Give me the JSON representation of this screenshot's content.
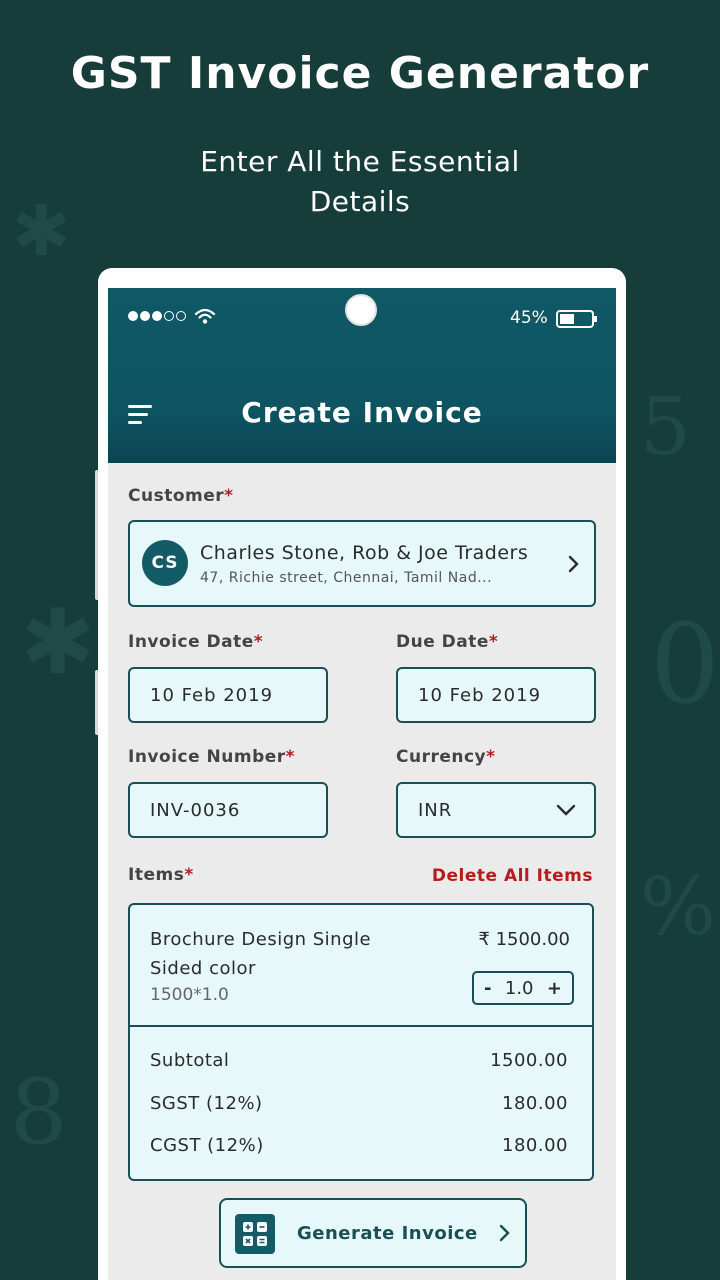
{
  "promo": {
    "title": "GST Invoice Generator",
    "subtitle": "Enter All the Essential Details"
  },
  "status_bar": {
    "battery_percent": "45%",
    "signal_bars_filled": 3,
    "signal_bars_total": 5
  },
  "app_bar": {
    "title": "Create Invoice",
    "menu_icon": "menu-icon"
  },
  "customer": {
    "label": "Customer",
    "required_mark": "*",
    "initials": "CS",
    "name": "Charles Stone, Rob & Joe Traders",
    "address": "47, Richie street, Chennai, Tamil Nad..."
  },
  "invoice_date": {
    "label": "Invoice Date",
    "required_mark": "*",
    "value": "10 Feb 2019"
  },
  "due_date": {
    "label": "Due Date",
    "required_mark": "*",
    "value": "10 Feb 2019"
  },
  "invoice_number": {
    "label": "Invoice Number",
    "required_mark": "*",
    "value": "INV-0036"
  },
  "currency": {
    "label": "Currency",
    "required_mark": "*",
    "value": "INR"
  },
  "items": {
    "label": "Items",
    "required_mark": "*",
    "delete_all_label": "Delete All Items",
    "list": [
      {
        "name": "Brochure Design Single Sided color",
        "calc": "1500*1.0",
        "price": "₹ 1500.00",
        "qty": "1.0",
        "minus": "-",
        "plus": "+"
      }
    ]
  },
  "summary": {
    "subtotal_label": "Subtotal",
    "subtotal_value": "1500.00",
    "sgst_label": "SGST (12%)",
    "sgst_value": "180.00",
    "cgst_label": "CGST (12%)",
    "cgst_value": "180.00"
  },
  "generate_button": {
    "label": "Generate Invoice"
  },
  "colors": {
    "background": "#173d3b",
    "app_bar": "#0f5866",
    "accent_border": "#1a4f55",
    "field_fill": "#e6f8f9",
    "required": "#b71c1c"
  }
}
